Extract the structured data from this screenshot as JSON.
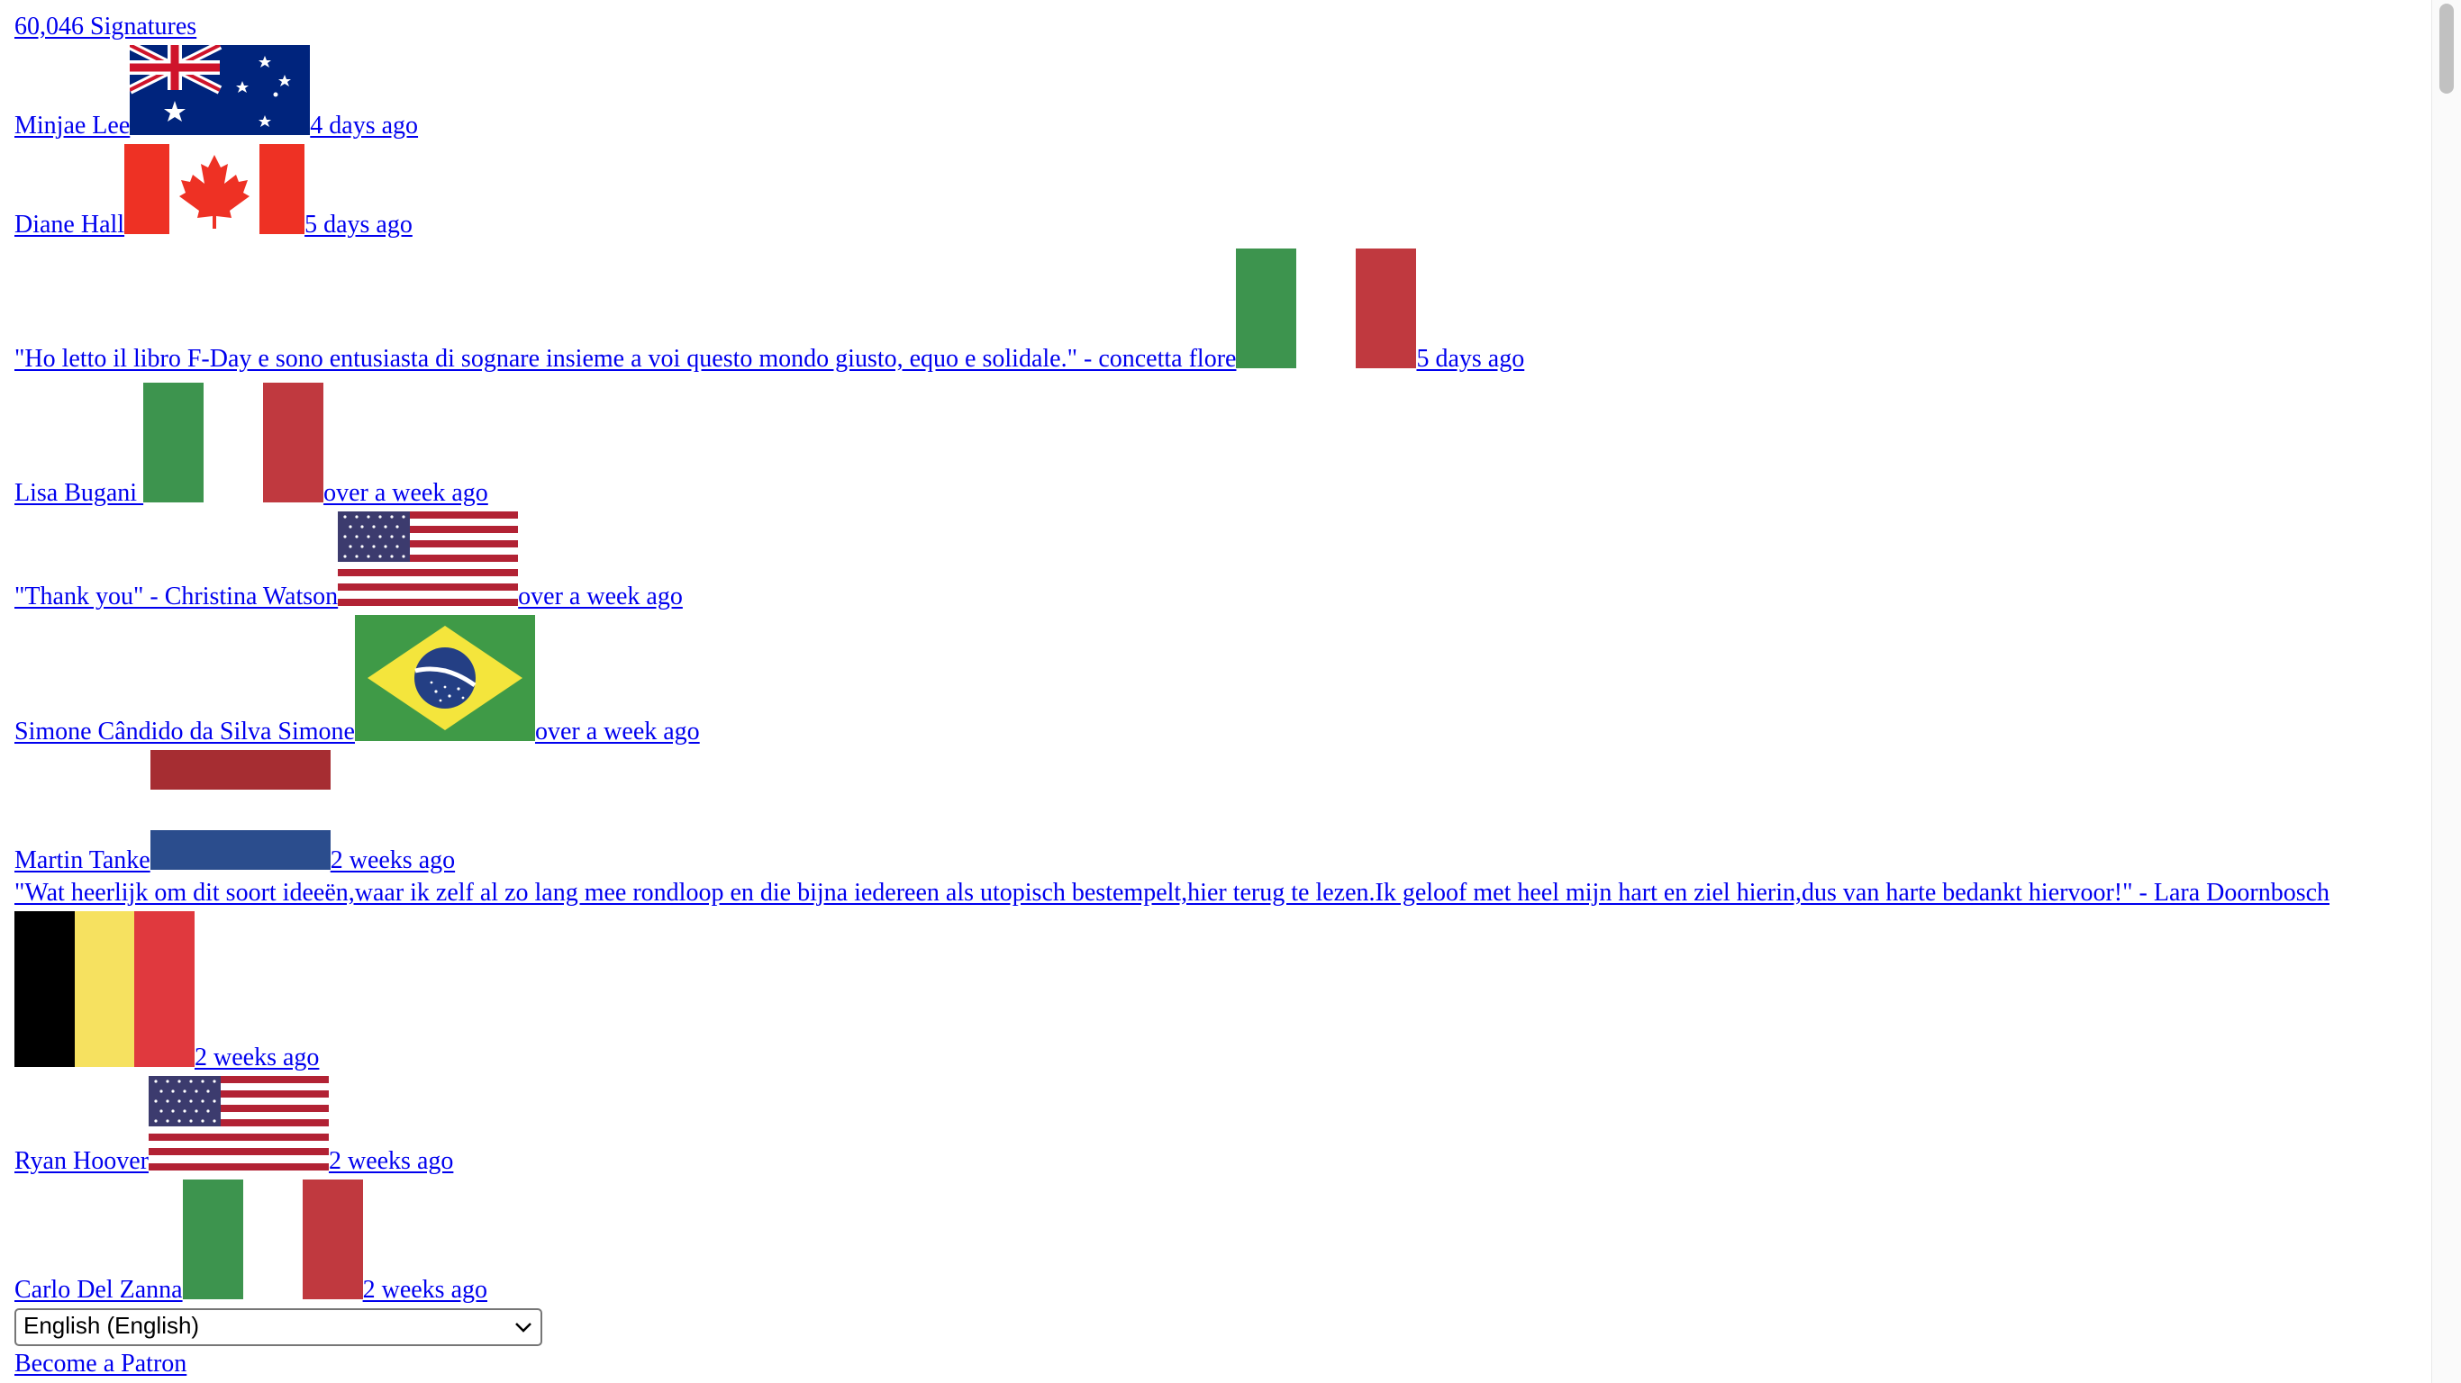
{
  "signature_count": "60,046 Signatures",
  "signatures": [
    {
      "name": "Minjae Lee",
      "flag": "australia-flag",
      "time": "4 days ago"
    },
    {
      "name": "Diane Hall",
      "flag": "canada-flag",
      "time": "5 days ago"
    },
    {
      "name": "\"Ho letto il libro F-Day e sono entusiasta di sognare insieme a voi questo mondo giusto, equo e solidale.\" - concetta flore",
      "flag": "italy-flag",
      "time": "5 days ago"
    },
    {
      "name": "Lisa Bugani ",
      "flag": "italy-flag",
      "time": "over a week ago"
    },
    {
      "name": "\"Thank you\" - Christina Watson",
      "flag": "usa-flag",
      "time": "over a week ago"
    },
    {
      "name": "Simone Cândido da Silva Simone",
      "flag": "brazil-flag",
      "time": "over a week ago"
    },
    {
      "name": "Martin Tanke",
      "flag": "netherlands-flag",
      "time": "2 weeks ago"
    },
    {
      "name": "\"Wat heerlijk om dit soort ideeën,waar ik zelf al zo lang mee rondloop en die bijna iedereen als utopisch bestempelt,hier terug te lezen.Ik geloof met heel mijn hart en ziel hierin,dus van harte bedankt hiervoor!\" - Lara Doornbosch",
      "flag": "belgium-flag",
      "time": "2 weeks ago"
    },
    {
      "name": "Ryan Hoover",
      "flag": "usa-flag",
      "time": "2 weeks ago"
    },
    {
      "name": "Carlo Del Zanna",
      "flag": "italy-flag",
      "time": "2 weeks ago"
    }
  ],
  "language_select": {
    "value": "English (English)",
    "icon": "chevron-down-icon"
  },
  "patron_link": "Become a Patron",
  "colors": {
    "link": "#0000ee",
    "italy_green": "#3d944e",
    "italy_red": "#c0393f",
    "canada_red": "#ee3124",
    "belgium_yellow": "#f6e160",
    "belgium_red": "#e0393e",
    "netherlands_red": "#a62d32",
    "netherlands_blue": "#2b4d8d",
    "brazil_green": "#3f9a47",
    "brazil_yellow": "#f4e53c",
    "brazil_blue": "#243f84",
    "aus_blue": "#00247d",
    "us_red": "#b22234",
    "us_blue": "#3c3b6e"
  }
}
